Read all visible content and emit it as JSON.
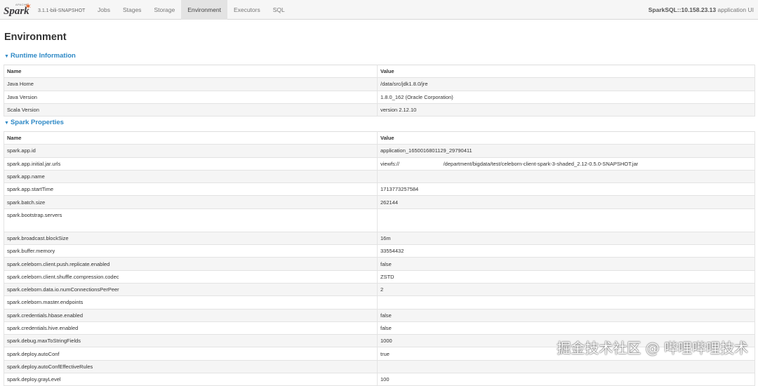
{
  "navbar": {
    "logo_text": "Spark",
    "logo_small": "APACHE",
    "version": "3.1.1-bili-SNAPSHOT",
    "tabs": [
      {
        "label": "Jobs"
      },
      {
        "label": "Stages"
      },
      {
        "label": "Storage"
      },
      {
        "label": "Environment"
      },
      {
        "label": "Executors"
      },
      {
        "label": "SQL"
      }
    ],
    "active_tab": "Environment",
    "app_title_bold": "SparkSQL::10.158.23.13",
    "app_title_suffix": " application UI"
  },
  "page": {
    "title": "Environment"
  },
  "runtime": {
    "header": "Runtime Information",
    "columns": [
      "Name",
      "Value"
    ],
    "rows": [
      [
        "Java Home",
        "/data/src/jdk1.8.0/jre"
      ],
      [
        "Java Version",
        "1.8.0_162 (Oracle Corporation)"
      ],
      [
        "Scala Version",
        "version 2.12.10"
      ]
    ]
  },
  "spark_properties": {
    "header": "Spark Properties",
    "columns": [
      "Name",
      "Value"
    ],
    "rows": [
      [
        "spark.app.id",
        "application_1650016801129_29790411"
      ],
      [
        "spark.app.initial.jar.urls",
        "viewfs://                              /department/bigdata/test/celeborn-client-spark-3-shaded_2.12-0.5.0-SNAPSHOT.jar"
      ],
      [
        "spark.app.name",
        ""
      ],
      [
        "spark.app.startTime",
        "1713773257584"
      ],
      [
        "spark.batch.size",
        "262144"
      ],
      [
        "spark.bootstrap.servers",
        ""
      ],
      [
        "spark.broadcast.blockSize",
        "16m"
      ],
      [
        "spark.buffer.memory",
        "33554432"
      ],
      [
        "spark.celeborn.client.push.replicate.enabled",
        "false"
      ],
      [
        "spark.celeborn.client.shuffle.compression.codec",
        "ZSTD"
      ],
      [
        "spark.celeborn.data.io.numConnectionsPerPeer",
        "2"
      ],
      [
        "spark.celeborn.master.endpoints",
        ""
      ],
      [
        "spark.credentials.hbase.enabled",
        "false"
      ],
      [
        "spark.credentials.hive.enabled",
        "false"
      ],
      [
        "spark.debug.maxToStringFields",
        "1000"
      ],
      [
        "spark.deploy.autoConf",
        "true"
      ],
      [
        "spark.deploy.autoConfEffectiveRules",
        ""
      ],
      [
        "spark.deploy.grayLevel",
        "100"
      ]
    ]
  },
  "watermark": "掘金技术社区 @ 哔哩哔哩技术",
  "colors": {
    "accent": "#2e89c6",
    "navbar_bg": "#f6f6f6",
    "active_tab_bg": "#e3e3e3",
    "stripe": "#f5f5f5",
    "logo_orange": "#e25a1c"
  }
}
